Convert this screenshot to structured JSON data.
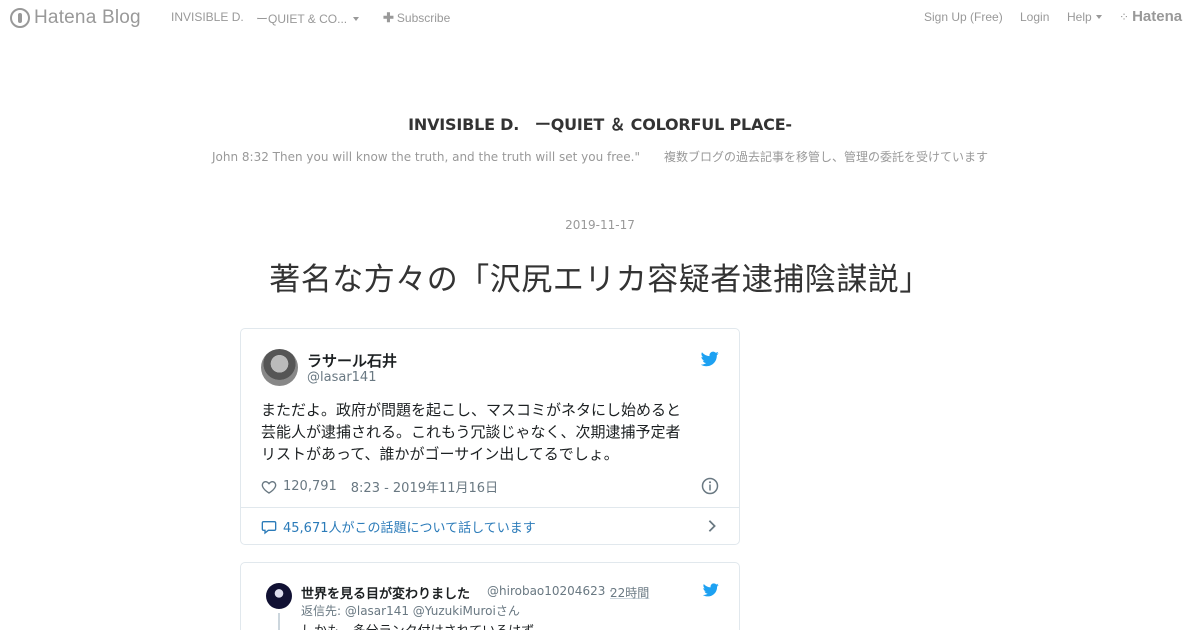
{
  "topbar": {
    "brand_text": "Hatena Blog",
    "blog_name_short": "INVISIBLE D.",
    "blog_name_short2": "ーQUIET & CO...",
    "subscribe": "Subscribe",
    "signup": "Sign Up (Free)",
    "login": "Login",
    "help": "Help",
    "hatena": "Hatena"
  },
  "blog": {
    "title": "INVISIBLE D.　ーQUIET ＆ COLORFUL PLACE-",
    "description": "John 8:32 Then you will know the truth, and the truth will set you free.\"　　複数ブログの過去記事を移管し、管理の委託を受けています"
  },
  "entry": {
    "date": "2019-11-17",
    "title": "著名な方々の「沢尻エリカ容疑者逮捕陰謀説」"
  },
  "tweet1": {
    "author_name": "ラサール石井",
    "author_handle": "@lasar141",
    "text_lines": [
      "まただよ。政府が問題を起こし、マスコミがネタにし始めると",
      "芸能人が逮捕される。これもう冗談じゃなく、次期逮捕予定者",
      "リストがあって、誰かがゴーサイン出してるでしょ。"
    ],
    "likes": "120,791",
    "timestamp": "8:23 - 2019年11月16日",
    "conversation": "45,671人がこの話題について話しています"
  },
  "tweet2": {
    "author_name": "世界を見る目が変わりました",
    "author_handle": "@hirobao10204623",
    "separator": "·",
    "time": "22時間",
    "reply_to": "返信先: @lasar141 @YuzukiMuroiさん",
    "text": "しかも、多分ランク付けされているはず。"
  },
  "colors": {
    "twitter_blue": "#1da1f2",
    "link_blue": "#2b7bb9",
    "muted": "#999999"
  },
  "icons": [
    "hatena-blog-logo-icon",
    "caret-down-icon",
    "plus-icon",
    "hatena-icon",
    "twitter-bird-icon",
    "heart-icon",
    "info-icon",
    "speech-bubble-icon",
    "chevron-right-icon"
  ]
}
